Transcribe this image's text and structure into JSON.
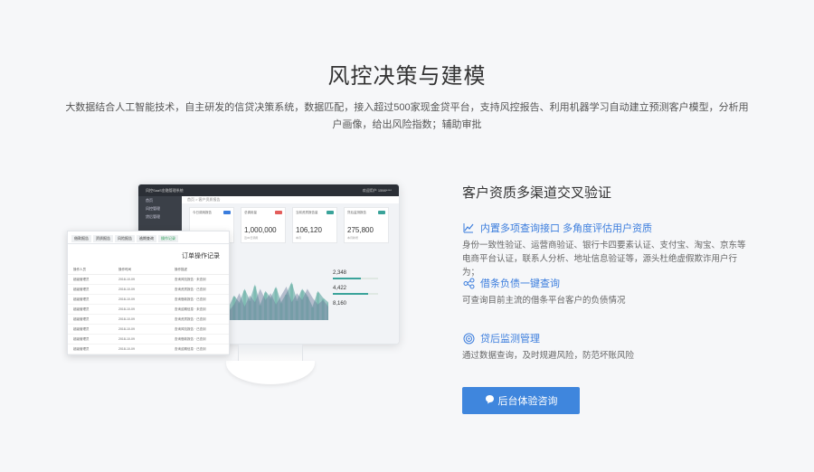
{
  "section": {
    "title": "风控决策与建模",
    "description": "大数据结合人工智能技术，自主研发的信贷决策系统，数据匹配，接入超过500家现金贷平台，支持风控报告、利用机器学习自动建立预测客户模型，分析用户画像，给出风险指数；辅助审批"
  },
  "monitor": {
    "brand": "风控SaaS金融管理系统",
    "user": "欢迎用户 1598****",
    "sidebar": [
      "首页",
      "风控管理",
      "贷后管理"
    ],
    "breadcrumb": "首页 > 客户资质报告",
    "cards": [
      {
        "label": "总调用量",
        "value": "1,000,000",
        "foot": "近30日调用",
        "tag_color": "#e35d5b"
      },
      {
        "label": "当前资质报告量",
        "value": "106,120",
        "foot": "本月",
        "tag_color": "#3aa39a"
      },
      {
        "label": "贷后监测报告",
        "value": "275,800",
        "foot": "本月新增",
        "tag_color": "#3aa39a"
      }
    ],
    "top_card": {
      "label": "今日调用报告",
      "tag_color": "#3b7ddd"
    },
    "stats": [
      {
        "value": "2,348",
        "fill": 0.62
      },
      {
        "value": "4,422",
        "fill": 0.78
      },
      {
        "value": "8,160",
        "fill": 0.5
      }
    ],
    "mini_chart": {
      "series_a": [
        30,
        55,
        40,
        70,
        45,
        80,
        35,
        65,
        50,
        75,
        40,
        60,
        85,
        45,
        70,
        55,
        30,
        65,
        50,
        40
      ],
      "series_b": [
        20,
        35,
        60,
        30,
        55,
        40,
        70,
        45,
        60,
        35,
        55,
        75,
        40,
        60,
        45,
        70,
        50,
        35,
        45,
        30
      ]
    }
  },
  "report": {
    "tabs": [
      "借款报告",
      "资质报告",
      "风险报告",
      "逾期查询",
      "操作记录"
    ],
    "active_tab_index": 4,
    "title": "订单操作记录",
    "headers": [
      "操作人员",
      "操作时间",
      "操作描述"
    ],
    "rows": [
      [
        "超级管理员",
        "2018-10-09",
        "查询风险报告 · 未查到"
      ],
      [
        "超级管理员",
        "2018-10-09",
        "查询资质报告 · 已查到"
      ],
      [
        "超级管理员",
        "2018-10-09",
        "查询借款报告 · 已查到"
      ],
      [
        "超级管理员",
        "2018-10-09",
        "查询逾期信息 · 未查到"
      ],
      [
        "超级管理员",
        "2018-10-09",
        "查询资质报告 · 已查到"
      ],
      [
        "超级管理员",
        "2018-10-09",
        "查询风险报告 · 已查到"
      ],
      [
        "超级管理员",
        "2018-10-09",
        "查询借款报告 · 已查到"
      ],
      [
        "超级管理员",
        "2018-10-09",
        "查询逾期信息 · 已查到"
      ]
    ]
  },
  "features": {
    "heading": "客户资质多渠道交叉验证",
    "items": [
      {
        "icon": "chart-line-icon",
        "title": "内置多项查询接口 多角度评估用户资质",
        "text": "身份一致性验证、运营商验证、银行卡四要素认证、支付宝、淘宝、京东等电商平台认证，联系人分析、地址信息验证等，源头杜绝虚假欺诈用户行为；"
      },
      {
        "icon": "nodes-icon",
        "title": "借条负债一键查询",
        "text": "可查询目前主流的借条平台客户的负债情况"
      },
      {
        "icon": "target-icon",
        "title": "贷后监测管理",
        "text": "通过数据查询，及时规避风险，防范坏账风险"
      }
    ]
  },
  "cta": {
    "label": "后台体验咨询",
    "icon": "chat-bubble-icon",
    "color": "#3f86dd"
  }
}
